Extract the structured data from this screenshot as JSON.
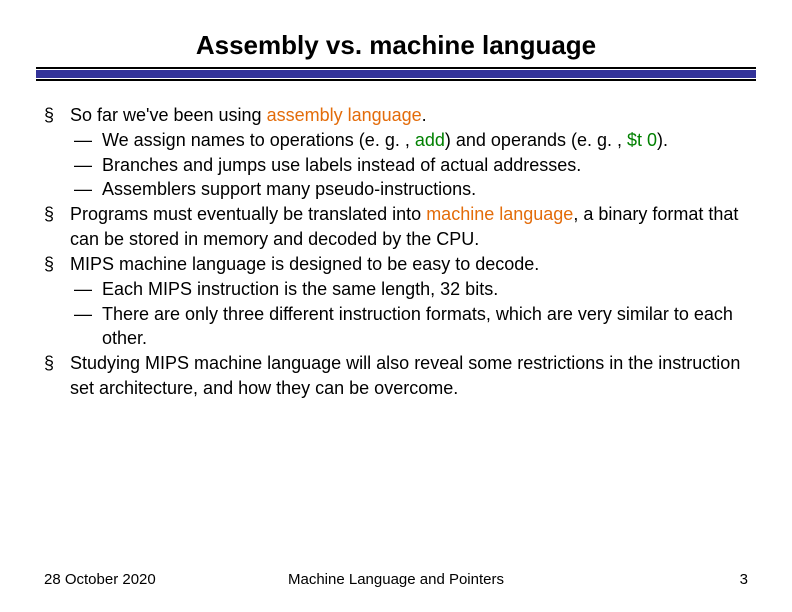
{
  "title": "Assembly vs. machine language",
  "bullets": {
    "b1_1_pre": "So far we've been using ",
    "b1_1_hl": "assembly language",
    "b1_1_post": ".",
    "b2_1_pre": "We assign names to operations (e. g. , ",
    "b2_1_hl1": "add",
    "b2_1_mid": ") and operands (e. g. , ",
    "b2_1_hl2": "$t 0",
    "b2_1_post": ").",
    "b2_2": "Branches and jumps use labels instead of actual addresses.",
    "b2_3": "Assemblers support many pseudo-instructions.",
    "b1_2_pre": "Programs must eventually be translated into ",
    "b1_2_hl": "machine language",
    "b1_2_post": ", a binary format that can be stored in memory and decoded by the CPU.",
    "b1_3": "MIPS machine language is designed to be easy to decode.",
    "b2_4": "Each MIPS instruction is the same length, 32 bits.",
    "b2_5": "There are only three different instruction formats, which are very similar to each other.",
    "b1_4": "Studying MIPS machine language will also reveal some restrictions in the instruction set architecture, and how they can be overcome."
  },
  "footer": {
    "date": "28 October 2020",
    "center": "Machine Language and Pointers",
    "page": "3"
  }
}
